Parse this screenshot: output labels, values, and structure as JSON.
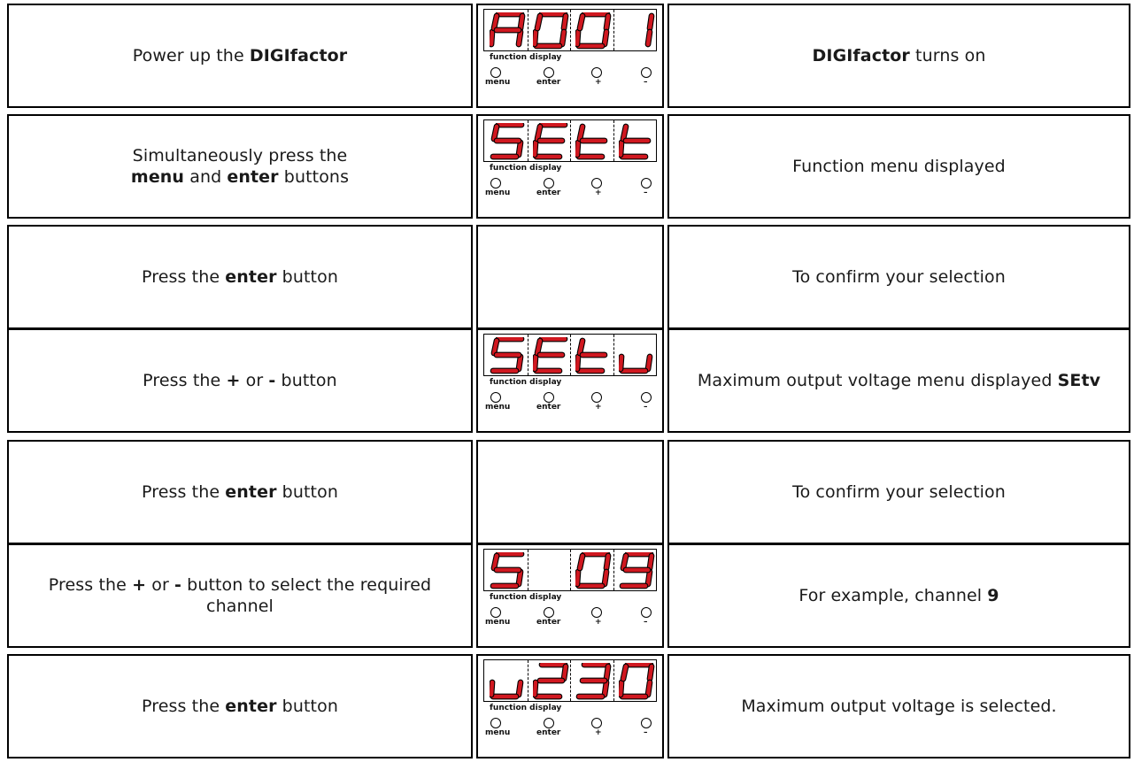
{
  "panel": {
    "display_label": "function display",
    "buttons": {
      "menu": "menu",
      "enter": "enter",
      "plus": "+",
      "minus": "–"
    },
    "segment_color": "#d01820"
  },
  "steps": [
    {
      "action": [
        [
          "Power up the ",
          false
        ],
        [
          "DIGIfactor",
          true
        ]
      ],
      "display": "A001",
      "result": [
        [
          "DIGIfactor",
          true
        ],
        [
          " turns on",
          false
        ]
      ]
    },
    {
      "action": [
        [
          "Simultaneously press the",
          false
        ],
        [
          "\n",
          false
        ],
        [
          "menu",
          true
        ],
        [
          " and ",
          false
        ],
        [
          "enter",
          true
        ],
        [
          " buttons",
          false
        ]
      ],
      "display": "SEtt",
      "result": [
        [
          "Function menu displayed",
          false
        ]
      ]
    },
    {
      "action": [
        [
          "Press the ",
          false
        ],
        [
          "enter",
          true
        ],
        [
          " button",
          false
        ]
      ],
      "display": "",
      "result": [
        [
          "To confirm your selection",
          false
        ]
      ]
    },
    {
      "action": [
        [
          "Press the ",
          false
        ],
        [
          "+",
          true
        ],
        [
          " or ",
          false
        ],
        [
          "-",
          true
        ],
        [
          " button",
          false
        ]
      ],
      "display": "SEtv",
      "result": [
        [
          "Maximum output voltage menu displayed ",
          false
        ],
        [
          "SEtv",
          true
        ]
      ]
    },
    {
      "action": [
        [
          "Press the ",
          false
        ],
        [
          "enter",
          true
        ],
        [
          " button",
          false
        ]
      ],
      "display": "",
      "result": [
        [
          "To confirm your selection",
          false
        ]
      ]
    },
    {
      "action": [
        [
          "Press the ",
          false
        ],
        [
          "+",
          true
        ],
        [
          " or ",
          false
        ],
        [
          "-",
          true
        ],
        [
          " button to select the required",
          false
        ],
        [
          "\n",
          false
        ],
        [
          "channel",
          false
        ]
      ],
      "display": "S 09",
      "result": [
        [
          "For example, channel ",
          false
        ],
        [
          "9",
          true
        ]
      ]
    },
    {
      "action": [
        [
          "Press the ",
          false
        ],
        [
          "enter",
          true
        ],
        [
          " button",
          false
        ]
      ],
      "display": "v230",
      "result": [
        [
          "Maximum output voltage is selected.",
          false
        ]
      ]
    }
  ]
}
